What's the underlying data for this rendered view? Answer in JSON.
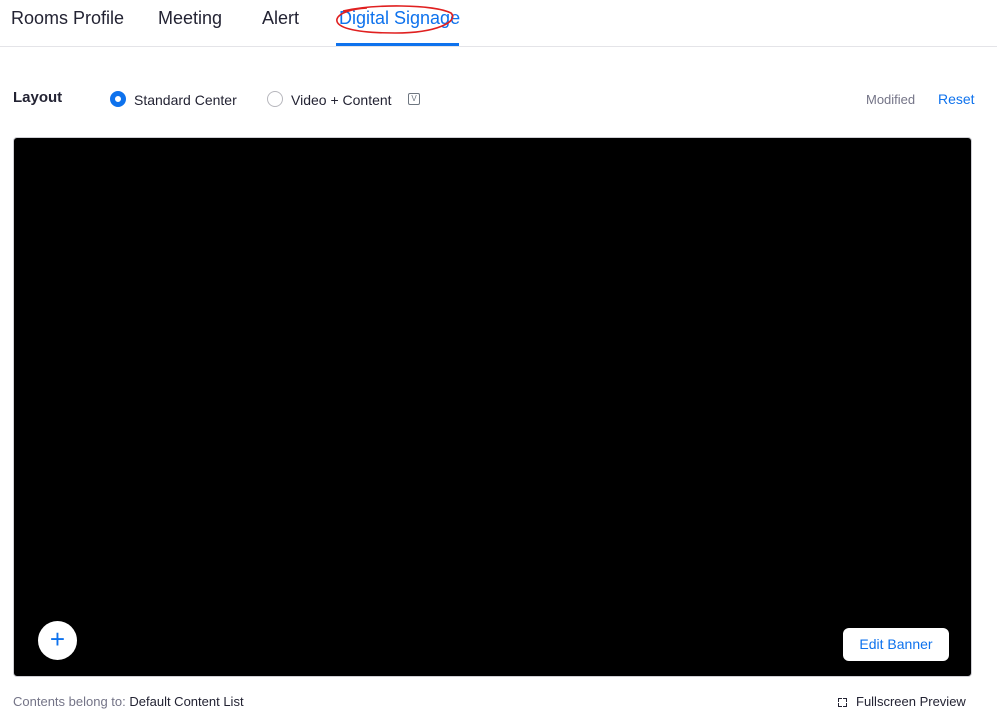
{
  "tabs": [
    {
      "label": "Rooms Profile",
      "active": false
    },
    {
      "label": "Meeting",
      "active": false
    },
    {
      "label": "Alert",
      "active": false
    },
    {
      "label": "Digital Signage",
      "active": true
    }
  ],
  "layout": {
    "label": "Layout",
    "options": [
      {
        "label": "Standard Center",
        "selected": true
      },
      {
        "label": "Video + Content",
        "selected": false
      }
    ],
    "info_icon": "v-icon",
    "modified_label": "Modified",
    "reset_label": "Reset"
  },
  "preview": {
    "background": "#000000",
    "add_icon": "+",
    "edit_banner_label": "Edit Banner"
  },
  "footer": {
    "contents_prefix": "Contents belong to:",
    "contents_value": "Default Content List",
    "fullscreen_label": "Fullscreen Preview"
  },
  "colors": {
    "accent": "#0e72ed",
    "annotation": "#e02020",
    "text": "#232333",
    "muted": "#747487"
  }
}
